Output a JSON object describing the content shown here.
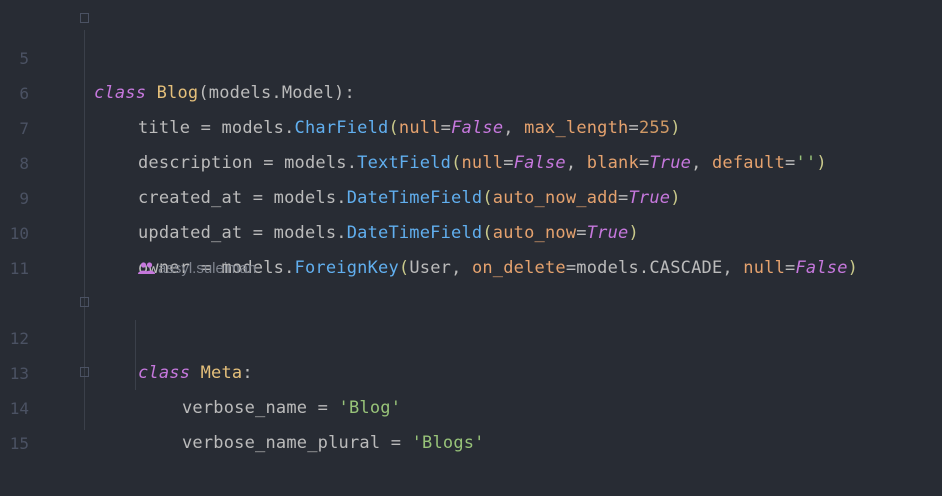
{
  "editor": {
    "line_numbers": [
      "5",
      "6",
      "7",
      "8",
      "9",
      "10",
      "11",
      "12",
      "13",
      "14",
      "15"
    ],
    "author_inlay": "assyl.suleiman",
    "code": {
      "l5": {
        "kw_class": "class",
        "space": " ",
        "name": "Blog",
        "rest": "(models.Model):"
      },
      "l6": {
        "a": "title = models.",
        "call": "CharField",
        "open": "(",
        "p1": "null",
        "eq1": "=",
        "v1": "False",
        "sep1": ", ",
        "p2": "max_length",
        "eq2": "=",
        "v2": "255",
        "close": ")"
      },
      "l7": {
        "a": "description = models.",
        "call": "TextField",
        "open": "(",
        "p1": "null",
        "eq1": "=",
        "v1": "False",
        "sep1": ", ",
        "p2": "blank",
        "eq2": "=",
        "v2": "True",
        "sep2": ", ",
        "p3": "default",
        "eq3": "=",
        "v3": "''",
        "close": ")"
      },
      "l8": {
        "a": "created_at = models.",
        "call": "DateTimeField",
        "open": "(",
        "p1": "auto_now_add",
        "eq1": "=",
        "v1": "True",
        "close": ")"
      },
      "l9": {
        "a": "updated_at = models.",
        "call": "DateTimeField",
        "open": "(",
        "p1": "auto_now",
        "eq1": "=",
        "v1": "True",
        "close": ")"
      },
      "l10": {
        "a": "owner = models.",
        "call": "ForeignKey",
        "open": "(",
        "arg": "User, ",
        "p1": "on_delete",
        "eq1": "=",
        "v1": "models.CASCADE, ",
        "p2": "null",
        "eq2": "=",
        "v2": "False",
        "close": ")"
      },
      "l12": {
        "kw_class": "class",
        "space": " ",
        "name": "Meta",
        "rest": ":"
      },
      "l13": {
        "a": "verbose_name = ",
        "str": "'Blog'"
      },
      "l14": {
        "a": "verbose_name_plural = ",
        "str": "'Blogs'"
      }
    },
    "colors": {
      "background": "#282c34",
      "keyword": "#c678dd",
      "class_name": "#e5c07b",
      "function": "#61afef",
      "parameter": "#e5a26e",
      "number": "#d19a66",
      "string": "#98c379",
      "line_number": "#4b5263"
    }
  }
}
